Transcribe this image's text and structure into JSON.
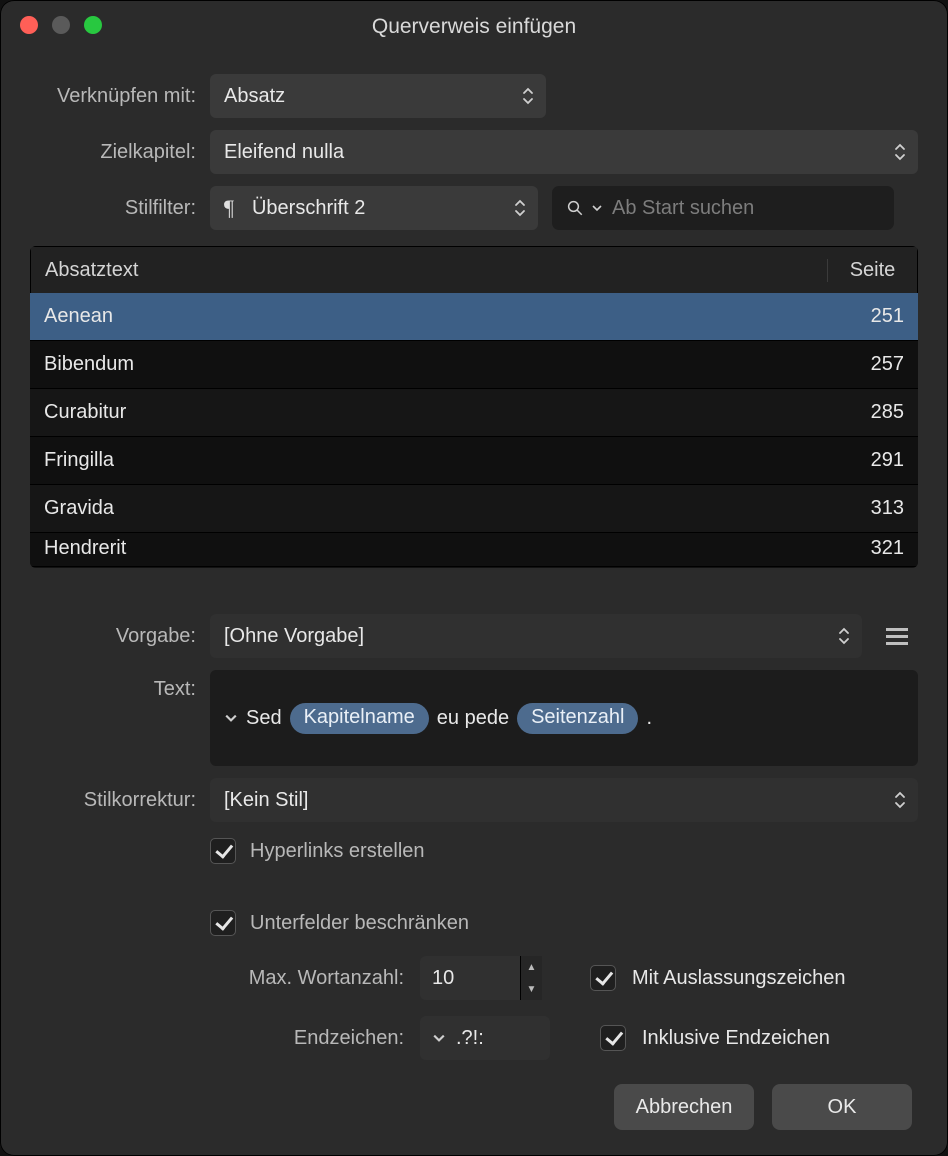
{
  "window": {
    "title": "Querverweis einfügen"
  },
  "labels": {
    "link_with": "Verknüpfen mit:",
    "target_chapter": "Zielkapitel:",
    "style_filter": "Stilfilter:",
    "preset": "Vorgabe:",
    "text": "Text:",
    "style_correction": "Stilkorrektur:",
    "max_words": "Max. Wortanzahl:",
    "end_chars": "Endzeichen:"
  },
  "values": {
    "link_with": "Absatz",
    "target_chapter": "Eleifend nulla",
    "style_filter": "Überschrift 2",
    "preset": "[Ohne Vorgabe]",
    "style_correction": "[Kein Stil]",
    "max_words": "10",
    "end_chars": ".?!:"
  },
  "search": {
    "placeholder": "Ab Start suchen"
  },
  "list": {
    "header_text": "Absatztext",
    "header_page": "Seite",
    "rows": [
      {
        "text": "Aenean",
        "page": "251",
        "selected": true
      },
      {
        "text": "Bibendum",
        "page": "257"
      },
      {
        "text": "Curabitur",
        "page": "285"
      },
      {
        "text": "Fringilla",
        "page": "291"
      },
      {
        "text": "Gravida",
        "page": "313"
      },
      {
        "text": "Hendrerit",
        "page": "321"
      }
    ]
  },
  "text_tokens": {
    "t0": "Sed",
    "pill0": "Kapitelname",
    "t1": "eu pede",
    "pill1": "Seitenzahl",
    "t2": "."
  },
  "checks": {
    "hyperlinks": "Hyperlinks erstellen",
    "restrict_sub": "Unterfelder beschränken",
    "ellipsis": "Mit Auslassungszeichen",
    "inclusive": "Inklusive Endzeichen"
  },
  "buttons": {
    "cancel": "Abbrechen",
    "ok": "OK"
  }
}
